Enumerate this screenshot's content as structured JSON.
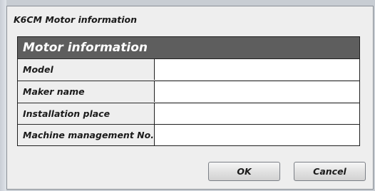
{
  "dialog": {
    "title": "K6CM Motor information"
  },
  "panel": {
    "header": "Motor information",
    "rows": [
      {
        "label": "Model",
        "value": ""
      },
      {
        "label": "Maker name",
        "value": ""
      },
      {
        "label": "Installation place",
        "value": ""
      },
      {
        "label": "Machine management No.",
        "value": ""
      }
    ]
  },
  "buttons": {
    "ok_label": "OK",
    "cancel_label": "Cancel"
  }
}
